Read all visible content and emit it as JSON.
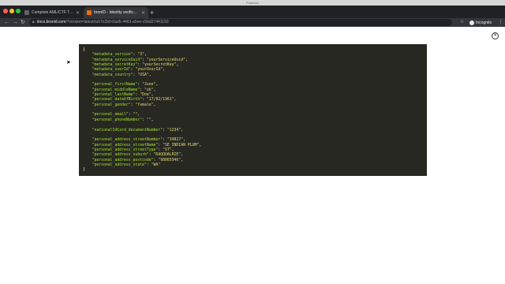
{
  "window": {
    "title": "Postman"
  },
  "tabs": [
    {
      "label": "Complete AML/CTF Toolkit | bri...",
      "active": false
    },
    {
      "label": "bronID - Identity verification",
      "active": true
    }
  ],
  "toolbar": {
    "url_host": "docs.bronid.com",
    "url_rest": "/?version=latest#a57e2b0-0ad5-4463-a5ee-c5bd27441150",
    "profile_label": "Incognito"
  },
  "code": {
    "open": "{",
    "close": "}",
    "groups": [
      [
        {
          "key": "\"metadata_version\"",
          "value": "\"3\""
        },
        {
          "key": "\"metadata_serviceUuid\"",
          "value": "\"yourServiceUuid\""
        },
        {
          "key": "\"metadata_secretKey\"",
          "value": "\"yourSecretKey\""
        },
        {
          "key": "\"metadata_userId\"",
          "value": "\"yourUserId\""
        },
        {
          "key": "\"metadata_country\"",
          "value": "\"USA\""
        }
      ],
      [
        {
          "key": "\"personal_firstName\"",
          "value": "\"June\""
        },
        {
          "key": "\"personal_middleName\"",
          "value": "\"ok\""
        },
        {
          "key": "\"personal_lastName\"",
          "value": "\"Doe\""
        },
        {
          "key": "\"personal_dateOfBirth\"",
          "value": "\"17/02/1961\""
        },
        {
          "key": "\"personal_gender\"",
          "value": "\"female\""
        }
      ],
      [
        {
          "key": "\"personal_email\"",
          "value": "\"\""
        },
        {
          "key": "\"personal_phoneNumber\"",
          "value": "\"\""
        }
      ],
      [
        {
          "key": "\"nationalIdCard_documentNumber\"",
          "value": "\"1234\""
        }
      ],
      [
        {
          "key": "\"personal_address_streetNumber\"",
          "value": "\"34827\""
        },
        {
          "key": "\"personal_address_streetName\"",
          "value": "\"SE INDIAN PLUM\""
        },
        {
          "key": "\"personal_address_streetType\"",
          "value": "\"ST\""
        },
        {
          "key": "\"personal_address_suburb\"",
          "value": "\"DAQQUALRIE\""
        },
        {
          "key": "\"personal_address_postcode\"",
          "value": "\"98065946\""
        },
        {
          "key": "\"personal_address_state\"",
          "value": "\"WA\""
        }
      ]
    ]
  },
  "colors": {
    "code_bg": "#272822",
    "code_key": "#a6e22e",
    "code_string": "#e6db74",
    "chrome_dark": "#202124"
  }
}
